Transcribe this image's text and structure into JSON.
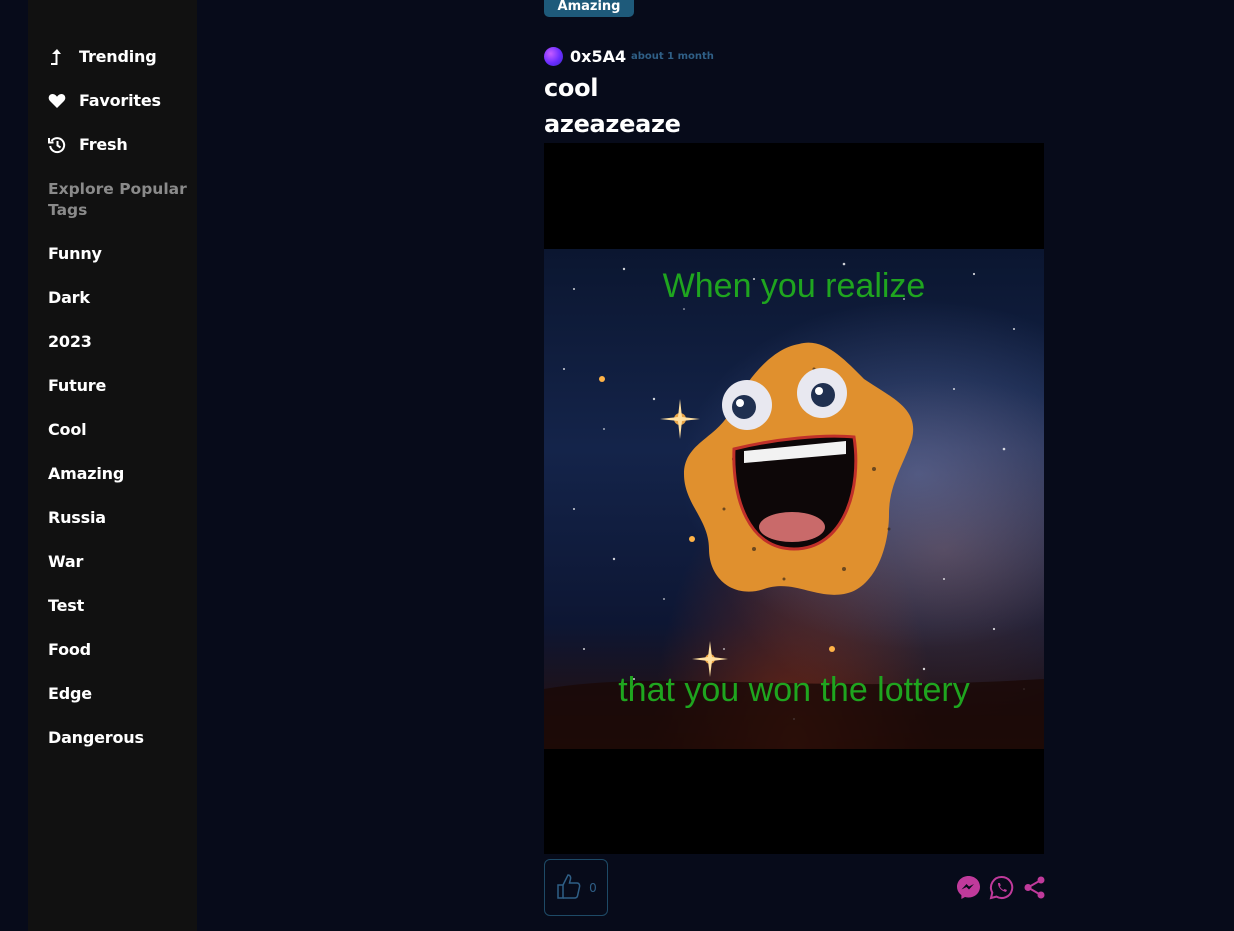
{
  "sidebar": {
    "nav": [
      {
        "label": "Trending",
        "icon": "trending-arrow-icon"
      },
      {
        "label": "Favorites",
        "icon": "heart-icon"
      },
      {
        "label": "Fresh",
        "icon": "history-icon"
      }
    ],
    "explore_heading": "Explore Popular Tags",
    "tags": [
      "Funny",
      "Dark",
      "2023",
      "Future",
      "Cool",
      "Amazing",
      "Russia",
      "War",
      "Test",
      "Food",
      "Edge",
      "Dangerous"
    ]
  },
  "post": {
    "top_tag": "Amazing",
    "author": "0x5A4",
    "time": "about 1 month",
    "title": "cool",
    "subtitle": "azeazeaze",
    "meme_top_text": "When you realize",
    "meme_bottom_text": "that you won the lottery",
    "likes": "0"
  },
  "colors": {
    "background": "#070b1a",
    "sidebar": "#111111",
    "accent_blue": "#1e5a7a",
    "share_pink": "#c03a9b",
    "meme_text": "#1fa51f"
  }
}
